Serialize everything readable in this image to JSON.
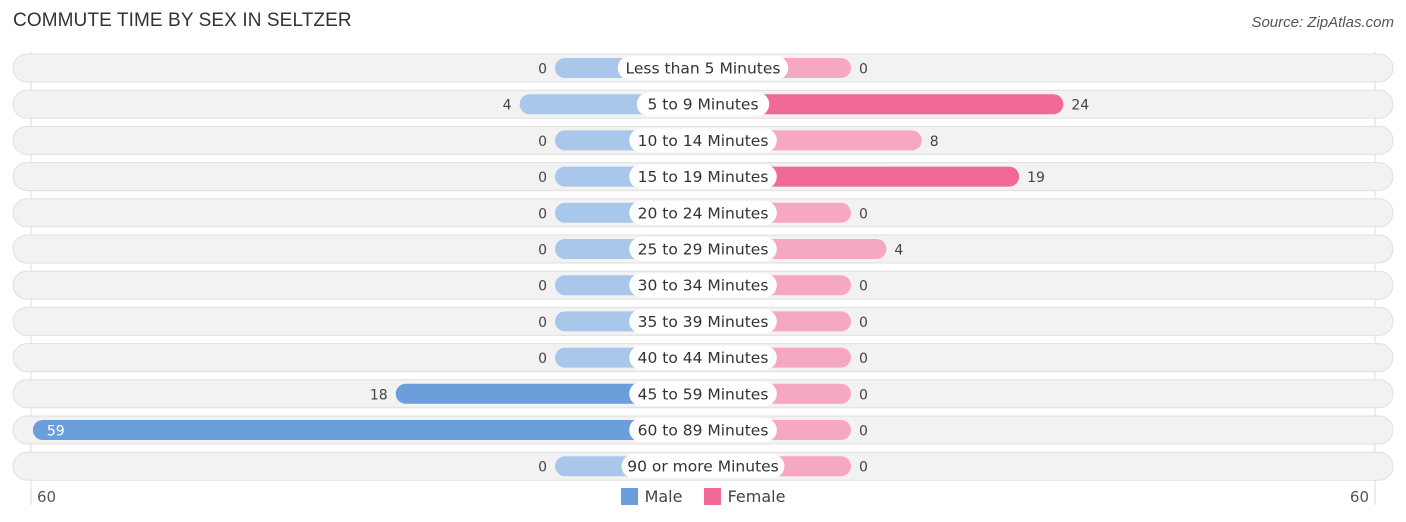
{
  "title": "COMMUTE TIME BY SEX IN SELTZER",
  "source": "Source: ZipAtlas.com",
  "legend": {
    "male": "Male",
    "female": "Female"
  },
  "colors": {
    "male": "#6a9fdc",
    "male_light": "#a9c7eb",
    "female": "#f06a95",
    "female_light": "#f7a8c1",
    "track": "#f2f2f2"
  },
  "axis": {
    "left_label": "60",
    "right_label": "60"
  },
  "chart_data": {
    "type": "bar",
    "orientation": "horizontal-diverging",
    "title": "COMMUTE TIME BY SEX IN SELTZER",
    "categories": [
      "Less than 5 Minutes",
      "5 to 9 Minutes",
      "10 to 14 Minutes",
      "15 to 19 Minutes",
      "20 to 24 Minutes",
      "25 to 29 Minutes",
      "30 to 34 Minutes",
      "35 to 39 Minutes",
      "40 to 44 Minutes",
      "45 to 59 Minutes",
      "60 to 89 Minutes",
      "90 or more Minutes"
    ],
    "series": [
      {
        "name": "Male",
        "values": [
          0,
          4,
          0,
          0,
          0,
          0,
          0,
          0,
          0,
          18,
          59,
          0
        ]
      },
      {
        "name": "Female",
        "values": [
          0,
          24,
          8,
          19,
          0,
          4,
          0,
          0,
          0,
          0,
          0,
          0
        ]
      }
    ],
    "xlim": [
      -60,
      60
    ],
    "xtick_labels": [
      "60",
      "60"
    ],
    "legend_position": "bottom-center",
    "grid": false
  }
}
